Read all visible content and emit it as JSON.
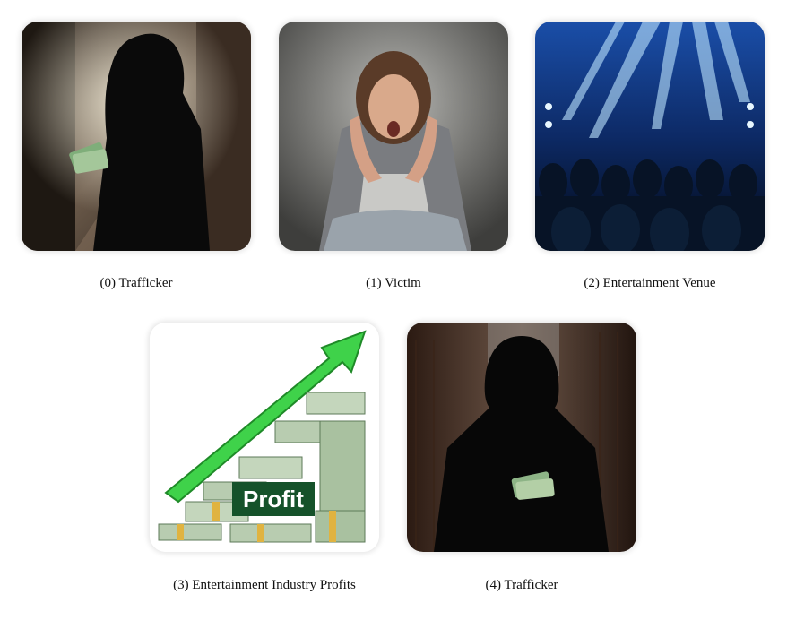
{
  "panels": [
    {
      "caption": "(0) Trafficker",
      "icon": "hooded-figure-with-cash-image"
    },
    {
      "caption": "(1) Victim",
      "icon": "distressed-woman-image"
    },
    {
      "caption": "(2) Entertainment Venue",
      "icon": "concert-crowd-image"
    },
    {
      "caption": "(3) Entertainment Industry Profits",
      "icon": "profit-money-stack-image",
      "sign_text": "Profit"
    },
    {
      "caption": "(4) Trafficker",
      "icon": "hooded-figure-in-alley-image"
    }
  ]
}
